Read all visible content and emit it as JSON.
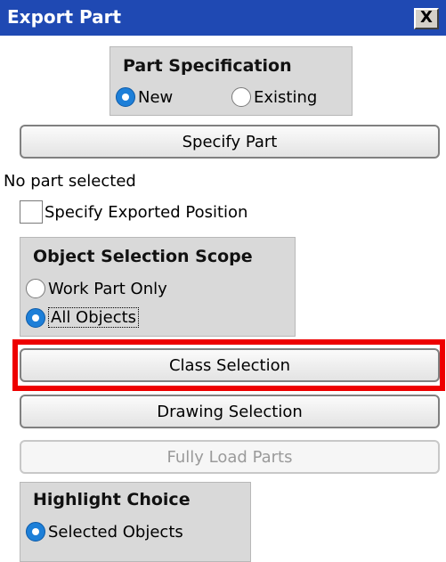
{
  "window": {
    "title": "Export Part",
    "close_symbol": "X"
  },
  "part_specification": {
    "title": "Part Specification",
    "options": [
      {
        "label": "New",
        "selected": true
      },
      {
        "label": "Existing",
        "selected": false
      }
    ]
  },
  "buttons": {
    "specify_part": "Specify Part",
    "class_selection": "Class Selection",
    "drawing_selection": "Drawing Selection",
    "fully_load_parts": "Fully Load Parts"
  },
  "status_text": "No part selected",
  "specify_exported_position": {
    "label": "Specify Exported Position",
    "checked": false
  },
  "object_selection_scope": {
    "title": "Object Selection Scope",
    "options": [
      {
        "label": "Work Part Only",
        "selected": false
      },
      {
        "label": "All Objects",
        "selected": true
      }
    ]
  },
  "highlight_choice": {
    "title": "Highlight Choice",
    "options": [
      {
        "label": "Selected Objects",
        "selected": true
      }
    ]
  },
  "colors": {
    "titlebar": "#1f49b3",
    "highlight": "#ee0000",
    "radio_selected": "#1d7fd8",
    "group_bg": "#d9d9d9"
  }
}
